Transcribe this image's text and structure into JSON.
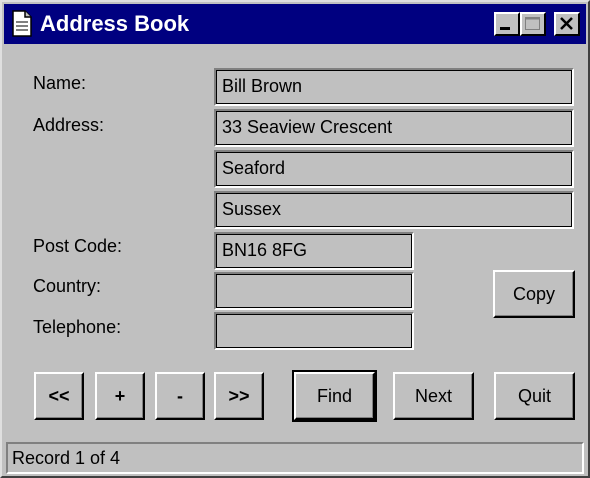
{
  "window": {
    "title": "Address Book",
    "title_icon": "document-icon",
    "controls": [
      "minimize-icon",
      "maximize-icon",
      "close-icon"
    ]
  },
  "form": {
    "name_label": "Name:",
    "address_label": "Address:",
    "postcode_label": "Post Code:",
    "country_label": "Country:",
    "telephone_label": "Telephone:",
    "name_value": "Bill Brown",
    "address_line1": "33 Seaview Crescent",
    "address_line2": "Seaford",
    "address_line3": "Sussex",
    "postcode_value": "BN16 8FG",
    "country_value": "",
    "telephone_value": ""
  },
  "buttons": {
    "copy": "Copy",
    "first": "<<",
    "add": "+",
    "remove": "-",
    "last": ">>",
    "find": "Find",
    "next": "Next",
    "quit": "Quit"
  },
  "status": {
    "text": "Record 1 of 4"
  },
  "colors": {
    "titlebar": "#000080",
    "face": "#c0c0c0"
  }
}
